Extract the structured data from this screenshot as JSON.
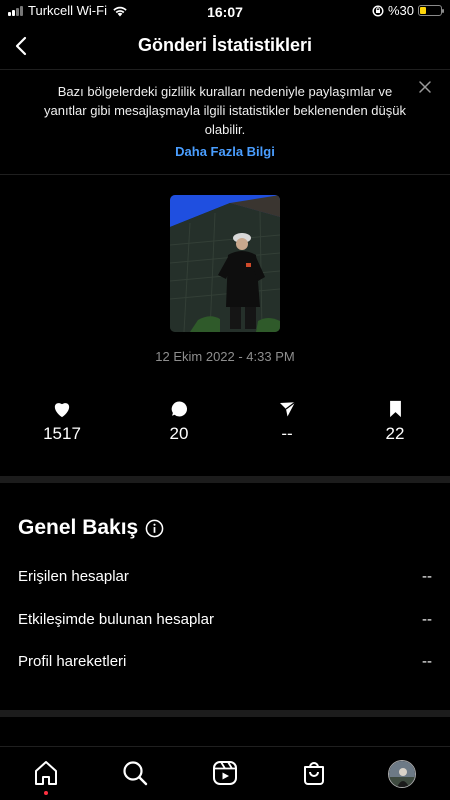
{
  "status_bar": {
    "carrier": "Turkcell Wi-Fi",
    "time": "16:07",
    "battery_text": "%30",
    "battery_level": 0.3
  },
  "header": {
    "title": "Gönderi İstatistikleri"
  },
  "notice": {
    "text": "Bazı bölgelerdeki gizlilik kuralları nedeniyle paylaşımlar ve yanıtlar gibi mesajlaşmayla ilgili istatistikler beklenenden düşük olabilir.",
    "link": "Daha Fazla Bilgi"
  },
  "post": {
    "date": "12 Ekim 2022 - 4:33 PM"
  },
  "stats": {
    "likes": "1517",
    "comments": "20",
    "shares": "--",
    "saves": "22"
  },
  "overview": {
    "title": "Genel Bakış",
    "rows": [
      {
        "label": "Erişilen hesaplar",
        "value": "--"
      },
      {
        "label": "Etkileşimde bulunan hesaplar",
        "value": "--"
      },
      {
        "label": "Profil hareketleri",
        "value": "--"
      }
    ]
  },
  "colors": {
    "background": "#000000",
    "link": "#4a9eff",
    "muted": "#8e8e8e",
    "notification_dot": "#ff3040",
    "battery": "#ffd60a"
  },
  "icons": {
    "back": "chevron-left-icon",
    "close": "close-icon",
    "likes": "heart-icon",
    "comments": "comment-icon",
    "shares": "send-icon",
    "saves": "bookmark-icon",
    "info": "info-icon",
    "tabs": [
      "home-icon",
      "search-icon",
      "reels-icon",
      "shop-icon",
      "profile-avatar"
    ]
  }
}
